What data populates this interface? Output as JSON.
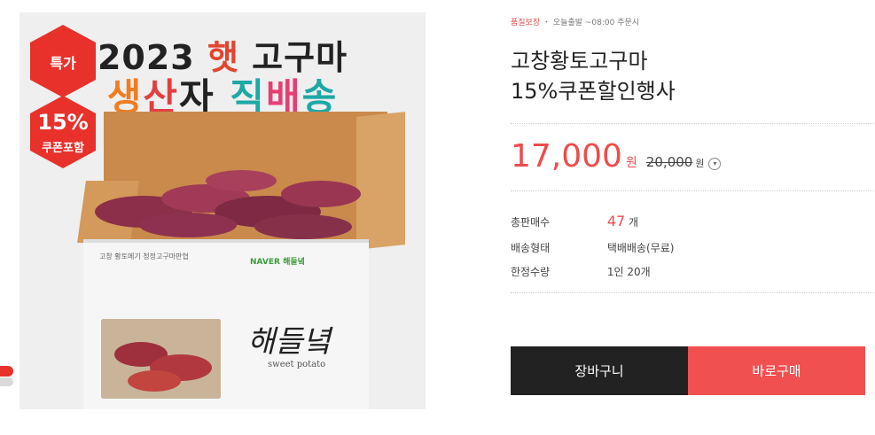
{
  "image": {
    "headline1_year": "2023",
    "headline1_new": "햇",
    "headline1_rest": "고구마",
    "headline2_parts": [
      "생",
      "산",
      "자",
      " 직",
      "배",
      "송"
    ],
    "badge_special": "특가",
    "badge_percent": "15%",
    "badge_coupon": "쿠폰포함",
    "box_brand": "고창 황토메기 청정고구마판협",
    "box_naver": "NAVER  해들녘",
    "box_script": "해들녘",
    "box_script_sub": "sweet potato"
  },
  "product": {
    "meta_quality": "품질보장",
    "meta_shipping": "오늘출발 ~08:00 주문시",
    "title_line1": "고창황토고구마",
    "title_line2": "15%쿠폰할인행사",
    "price": "17,000",
    "price_unit": "원",
    "original_price": "20,000",
    "original_unit": "원",
    "info_icon": "info-icon"
  },
  "details": {
    "total_sales_label": "총판매수",
    "total_sales_value": "47",
    "total_sales_unit": "개",
    "delivery_label": "배송형태",
    "delivery_value": "택배배송(무료)",
    "limit_label": "한정수량",
    "limit_value": "1인 20개"
  },
  "buttons": {
    "cart": "장바구니",
    "buy": "바로구매"
  },
  "colors": {
    "accent": "#ee4c4c",
    "dark": "#222222"
  }
}
